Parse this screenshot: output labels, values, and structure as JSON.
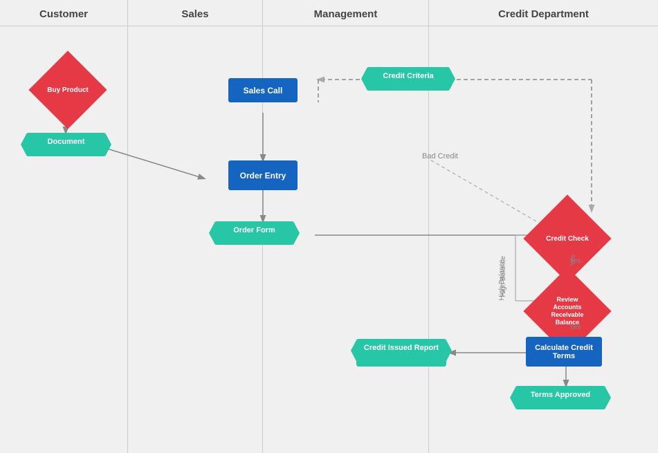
{
  "lanes": [
    {
      "id": "customer",
      "label": "Customer"
    },
    {
      "id": "sales",
      "label": "Sales"
    },
    {
      "id": "management",
      "label": "Management"
    },
    {
      "id": "credit",
      "label": "Credit Department"
    }
  ],
  "shapes": {
    "buy_product": "Buy Product",
    "document": "Document",
    "sales_call": "Sales Call",
    "order_entry": "Order Entry",
    "order_form": "Order Form",
    "credit_criteria": "Credit Criteria",
    "credit_check": "Credit Check",
    "review_ar": "Review Accounts Receivable Balance",
    "calculate_credit_terms": "Calculate Credit Terms",
    "credit_issued_report": "Credit Issued Report",
    "terms_approved": "Terms Approved"
  },
  "labels": {
    "bad_credit": "Bad Credit",
    "high_balance": "High Balance",
    "yes1": "Yes",
    "yes2": "Yes"
  }
}
